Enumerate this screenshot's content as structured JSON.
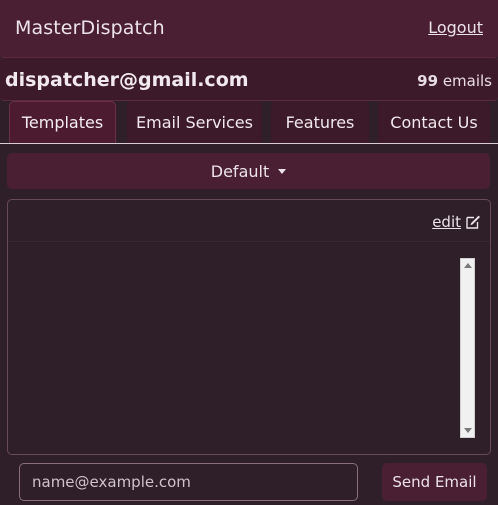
{
  "header": {
    "app_title": "MasterDispatch",
    "logout_label": "Logout"
  },
  "account": {
    "email": "dispatcher@gmail.com",
    "email_count": "99",
    "email_count_unit": "emails"
  },
  "tabs": [
    {
      "label": "Templates",
      "active": true
    },
    {
      "label": "Email Services",
      "active": false
    },
    {
      "label": "Features",
      "active": false
    },
    {
      "label": "Contact Us",
      "active": false
    }
  ],
  "template_selector": {
    "selected": "Default"
  },
  "editor": {
    "edit_label": "edit",
    "edit_icon": "pencil-square-icon",
    "body": ""
  },
  "send": {
    "recipient_placeholder": "name@example.com",
    "recipient_value": "",
    "button_label": "Send Email"
  },
  "colors": {
    "background": "#2f1f28",
    "accent": "#4a1f33"
  }
}
